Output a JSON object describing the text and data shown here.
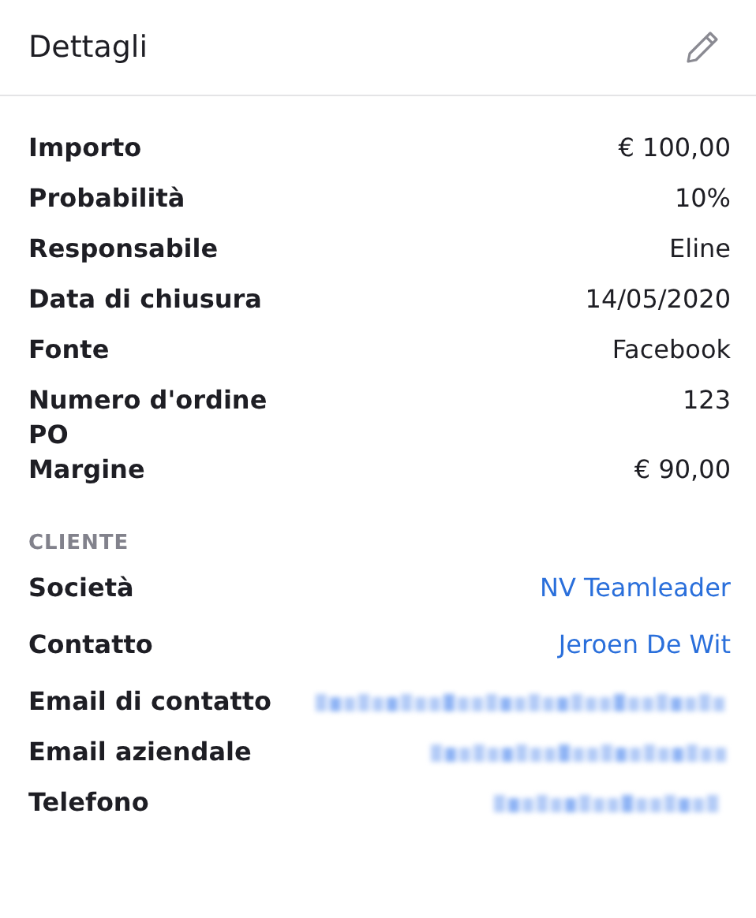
{
  "header": {
    "title": "Dettagli"
  },
  "details": [
    {
      "label": "Importo",
      "value": "€ 100,00",
      "kind": "text"
    },
    {
      "label": "Probabilità",
      "value": "10%",
      "kind": "text"
    },
    {
      "label": "Responsabile",
      "value": "Eline",
      "kind": "text"
    },
    {
      "label": "Data di chiusura",
      "value": "14/05/2020",
      "kind": "text"
    },
    {
      "label": "Fonte",
      "value": "Facebook",
      "kind": "text"
    },
    {
      "label": "Numero d'ordine PO",
      "value": "123",
      "kind": "text"
    },
    {
      "label": "Margine",
      "value": "€ 90,00",
      "kind": "text"
    }
  ],
  "client": {
    "heading": "CLIENTE",
    "rows": [
      {
        "label": "Società",
        "value": "NV Teamleader",
        "kind": "link"
      },
      {
        "label": "Contatto",
        "value": "Jeroen De Wit",
        "kind": "link"
      },
      {
        "label": "Email di contatto",
        "kind": "blurred"
      },
      {
        "label": "Email aziendale",
        "kind": "blurred"
      },
      {
        "label": "Telefono",
        "kind": "blurred"
      }
    ]
  }
}
